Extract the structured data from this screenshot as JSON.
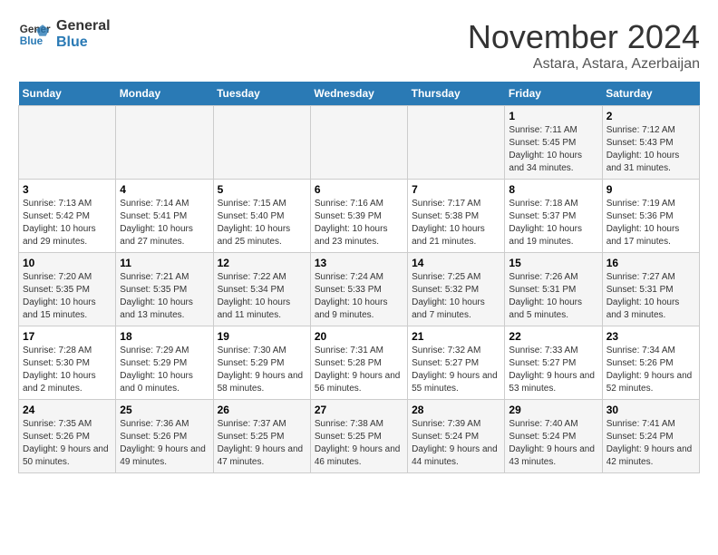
{
  "logo": {
    "line1": "General",
    "line2": "Blue"
  },
  "title": "November 2024",
  "location": "Astara, Astara, Azerbaijan",
  "weekdays": [
    "Sunday",
    "Monday",
    "Tuesday",
    "Wednesday",
    "Thursday",
    "Friday",
    "Saturday"
  ],
  "weeks": [
    [
      {
        "day": "",
        "info": ""
      },
      {
        "day": "",
        "info": ""
      },
      {
        "day": "",
        "info": ""
      },
      {
        "day": "",
        "info": ""
      },
      {
        "day": "",
        "info": ""
      },
      {
        "day": "1",
        "info": "Sunrise: 7:11 AM\nSunset: 5:45 PM\nDaylight: 10 hours and 34 minutes."
      },
      {
        "day": "2",
        "info": "Sunrise: 7:12 AM\nSunset: 5:43 PM\nDaylight: 10 hours and 31 minutes."
      }
    ],
    [
      {
        "day": "3",
        "info": "Sunrise: 7:13 AM\nSunset: 5:42 PM\nDaylight: 10 hours and 29 minutes."
      },
      {
        "day": "4",
        "info": "Sunrise: 7:14 AM\nSunset: 5:41 PM\nDaylight: 10 hours and 27 minutes."
      },
      {
        "day": "5",
        "info": "Sunrise: 7:15 AM\nSunset: 5:40 PM\nDaylight: 10 hours and 25 minutes."
      },
      {
        "day": "6",
        "info": "Sunrise: 7:16 AM\nSunset: 5:39 PM\nDaylight: 10 hours and 23 minutes."
      },
      {
        "day": "7",
        "info": "Sunrise: 7:17 AM\nSunset: 5:38 PM\nDaylight: 10 hours and 21 minutes."
      },
      {
        "day": "8",
        "info": "Sunrise: 7:18 AM\nSunset: 5:37 PM\nDaylight: 10 hours and 19 minutes."
      },
      {
        "day": "9",
        "info": "Sunrise: 7:19 AM\nSunset: 5:36 PM\nDaylight: 10 hours and 17 minutes."
      }
    ],
    [
      {
        "day": "10",
        "info": "Sunrise: 7:20 AM\nSunset: 5:35 PM\nDaylight: 10 hours and 15 minutes."
      },
      {
        "day": "11",
        "info": "Sunrise: 7:21 AM\nSunset: 5:35 PM\nDaylight: 10 hours and 13 minutes."
      },
      {
        "day": "12",
        "info": "Sunrise: 7:22 AM\nSunset: 5:34 PM\nDaylight: 10 hours and 11 minutes."
      },
      {
        "day": "13",
        "info": "Sunrise: 7:24 AM\nSunset: 5:33 PM\nDaylight: 10 hours and 9 minutes."
      },
      {
        "day": "14",
        "info": "Sunrise: 7:25 AM\nSunset: 5:32 PM\nDaylight: 10 hours and 7 minutes."
      },
      {
        "day": "15",
        "info": "Sunrise: 7:26 AM\nSunset: 5:31 PM\nDaylight: 10 hours and 5 minutes."
      },
      {
        "day": "16",
        "info": "Sunrise: 7:27 AM\nSunset: 5:31 PM\nDaylight: 10 hours and 3 minutes."
      }
    ],
    [
      {
        "day": "17",
        "info": "Sunrise: 7:28 AM\nSunset: 5:30 PM\nDaylight: 10 hours and 2 minutes."
      },
      {
        "day": "18",
        "info": "Sunrise: 7:29 AM\nSunset: 5:29 PM\nDaylight: 10 hours and 0 minutes."
      },
      {
        "day": "19",
        "info": "Sunrise: 7:30 AM\nSunset: 5:29 PM\nDaylight: 9 hours and 58 minutes."
      },
      {
        "day": "20",
        "info": "Sunrise: 7:31 AM\nSunset: 5:28 PM\nDaylight: 9 hours and 56 minutes."
      },
      {
        "day": "21",
        "info": "Sunrise: 7:32 AM\nSunset: 5:27 PM\nDaylight: 9 hours and 55 minutes."
      },
      {
        "day": "22",
        "info": "Sunrise: 7:33 AM\nSunset: 5:27 PM\nDaylight: 9 hours and 53 minutes."
      },
      {
        "day": "23",
        "info": "Sunrise: 7:34 AM\nSunset: 5:26 PM\nDaylight: 9 hours and 52 minutes."
      }
    ],
    [
      {
        "day": "24",
        "info": "Sunrise: 7:35 AM\nSunset: 5:26 PM\nDaylight: 9 hours and 50 minutes."
      },
      {
        "day": "25",
        "info": "Sunrise: 7:36 AM\nSunset: 5:26 PM\nDaylight: 9 hours and 49 minutes."
      },
      {
        "day": "26",
        "info": "Sunrise: 7:37 AM\nSunset: 5:25 PM\nDaylight: 9 hours and 47 minutes."
      },
      {
        "day": "27",
        "info": "Sunrise: 7:38 AM\nSunset: 5:25 PM\nDaylight: 9 hours and 46 minutes."
      },
      {
        "day": "28",
        "info": "Sunrise: 7:39 AM\nSunset: 5:24 PM\nDaylight: 9 hours and 44 minutes."
      },
      {
        "day": "29",
        "info": "Sunrise: 7:40 AM\nSunset: 5:24 PM\nDaylight: 9 hours and 43 minutes."
      },
      {
        "day": "30",
        "info": "Sunrise: 7:41 AM\nSunset: 5:24 PM\nDaylight: 9 hours and 42 minutes."
      }
    ]
  ]
}
